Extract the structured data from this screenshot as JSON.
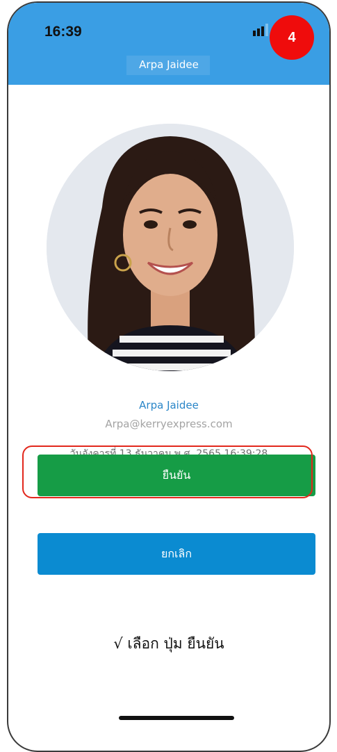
{
  "status_bar": {
    "time": "16:39"
  },
  "header": {
    "title": "Arpa Jaidee"
  },
  "step_badge": "4",
  "profile": {
    "name": "Arpa Jaidee",
    "email": "Arpa@kerryexpress.com",
    "datetime": "วันอังคารที่ 13 ธันวาคม พ.ศ. 2565 16:39:28"
  },
  "buttons": {
    "confirm_label": "ยืนยัน",
    "cancel_label": "ยกเลิก"
  },
  "instruction": "√ เลือก ปุ่ม ยืนยัน",
  "colors": {
    "header": "#3a9ee4",
    "confirm": "#169c46",
    "cancel": "#0b8bd1",
    "badge": "#ef0c0c",
    "highlight_outline": "#e2271c",
    "name_text": "#2a86c8"
  }
}
